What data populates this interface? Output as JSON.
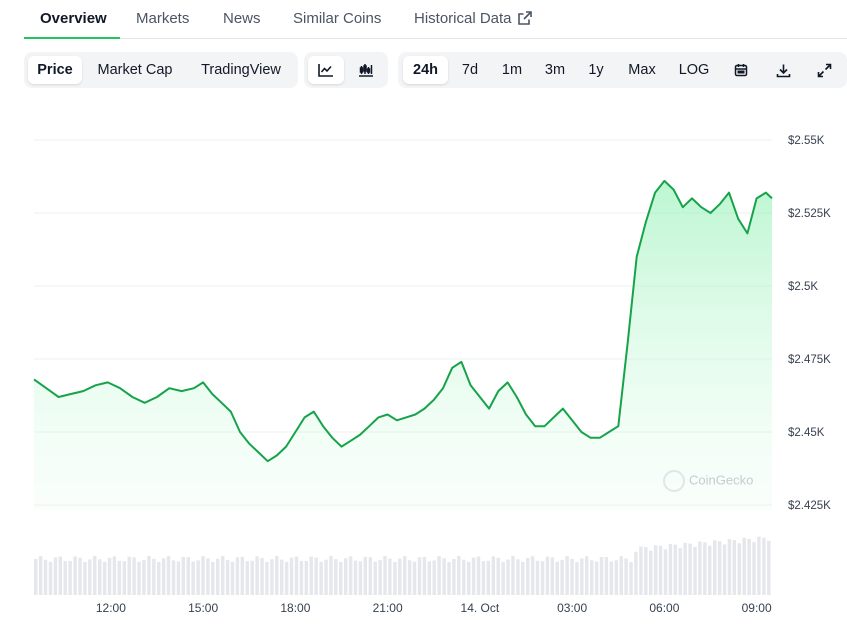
{
  "nav": {
    "tabs": [
      {
        "label": "Overview",
        "active": true
      },
      {
        "label": "Markets"
      },
      {
        "label": "News"
      },
      {
        "label": "Similar Coins"
      },
      {
        "label": "Historical Data",
        "icon": "external-link-icon"
      }
    ]
  },
  "toolbar": {
    "metric_tabs": [
      "Price",
      "Market Cap",
      "TradingView"
    ],
    "active_metric": "Price",
    "chart_type_icons": [
      "line-chart-icon",
      "candlestick-chart-icon"
    ],
    "active_chart_type": "line-chart-icon",
    "ranges": [
      "24h",
      "7d",
      "1m",
      "3m",
      "1y",
      "Max",
      "LOG"
    ],
    "active_range": "24h",
    "action_icons": [
      "calendar-icon",
      "download-icon",
      "expand-icon"
    ]
  },
  "watermark": "CoinGecko",
  "colors": {
    "accent": "#22c55e",
    "line": "#16a34a",
    "fill": "#bbf7d0",
    "volume": "#e5e7eb"
  },
  "chart_data": {
    "type": "area",
    "y_ticks": [
      "$2.55K",
      "$2.525K",
      "$2.5K",
      "$2.475K",
      "$2.45K",
      "$2.425K"
    ],
    "y_tick_values": [
      2550,
      2525,
      2500,
      2475,
      2450,
      2425
    ],
    "ylim": [
      2425,
      2550
    ],
    "x_ticks": [
      "12:00",
      "15:00",
      "18:00",
      "21:00",
      "14. Oct",
      "03:00",
      "06:00",
      "09:00"
    ],
    "x_tick_hours": [
      2.5,
      5.5,
      8.5,
      11.5,
      14.5,
      17.5,
      20.5,
      23.5
    ],
    "xlim_hours": [
      0,
      24
    ],
    "grid": true,
    "series": [
      {
        "values": [
          [
            0,
            2468
          ],
          [
            0.4,
            2465
          ],
          [
            0.8,
            2462
          ],
          [
            1.2,
            2463
          ],
          [
            1.6,
            2464
          ],
          [
            2.0,
            2466
          ],
          [
            2.4,
            2467
          ],
          [
            2.8,
            2465
          ],
          [
            3.2,
            2462
          ],
          [
            3.6,
            2460
          ],
          [
            4.0,
            2462
          ],
          [
            4.4,
            2465
          ],
          [
            4.8,
            2464
          ],
          [
            5.2,
            2465
          ],
          [
            5.5,
            2467
          ],
          [
            5.8,
            2463
          ],
          [
            6.1,
            2460
          ],
          [
            6.4,
            2457
          ],
          [
            6.7,
            2450
          ],
          [
            7.0,
            2446
          ],
          [
            7.3,
            2443
          ],
          [
            7.6,
            2440
          ],
          [
            7.9,
            2442
          ],
          [
            8.2,
            2445
          ],
          [
            8.5,
            2450
          ],
          [
            8.8,
            2455
          ],
          [
            9.1,
            2457
          ],
          [
            9.4,
            2452
          ],
          [
            9.7,
            2448
          ],
          [
            10.0,
            2445
          ],
          [
            10.3,
            2447
          ],
          [
            10.6,
            2449
          ],
          [
            10.9,
            2452
          ],
          [
            11.2,
            2455
          ],
          [
            11.5,
            2456
          ],
          [
            11.8,
            2454
          ],
          [
            12.1,
            2455
          ],
          [
            12.4,
            2456
          ],
          [
            12.7,
            2458
          ],
          [
            13.0,
            2461
          ],
          [
            13.3,
            2465
          ],
          [
            13.6,
            2472
          ],
          [
            13.9,
            2474
          ],
          [
            14.2,
            2466
          ],
          [
            14.5,
            2462
          ],
          [
            14.8,
            2458
          ],
          [
            15.1,
            2464
          ],
          [
            15.4,
            2467
          ],
          [
            15.7,
            2462
          ],
          [
            16.0,
            2456
          ],
          [
            16.3,
            2452
          ],
          [
            16.6,
            2452
          ],
          [
            16.9,
            2455
          ],
          [
            17.2,
            2458
          ],
          [
            17.5,
            2454
          ],
          [
            17.8,
            2450
          ],
          [
            18.1,
            2448
          ],
          [
            18.4,
            2448
          ],
          [
            18.7,
            2450
          ],
          [
            19.0,
            2452
          ],
          [
            19.3,
            2480
          ],
          [
            19.6,
            2510
          ],
          [
            19.9,
            2522
          ],
          [
            20.2,
            2532
          ],
          [
            20.5,
            2536
          ],
          [
            20.8,
            2533
          ],
          [
            21.1,
            2527
          ],
          [
            21.4,
            2530
          ],
          [
            21.7,
            2527
          ],
          [
            22.0,
            2525
          ],
          [
            22.3,
            2528
          ],
          [
            22.6,
            2532
          ],
          [
            22.9,
            2523
          ],
          [
            23.2,
            2518
          ],
          [
            23.5,
            2530
          ],
          [
            23.8,
            2532
          ],
          [
            24.0,
            2530
          ]
        ]
      }
    ]
  }
}
